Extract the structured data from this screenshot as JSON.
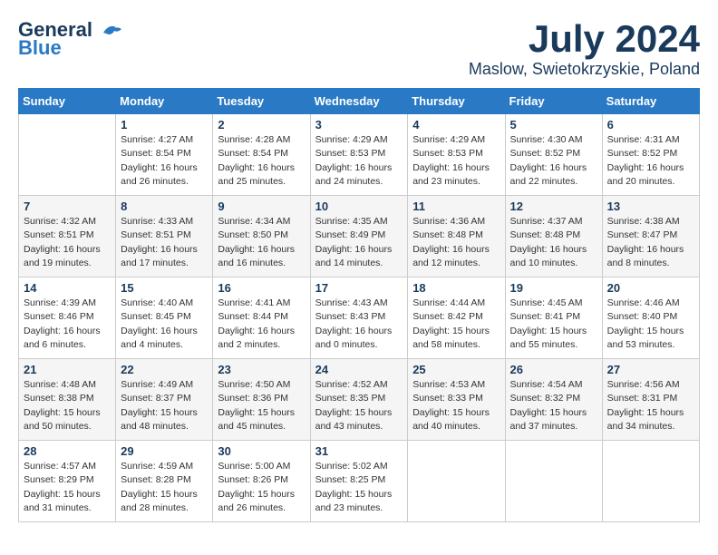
{
  "header": {
    "logo_general": "General",
    "logo_blue": "Blue",
    "month_year": "July 2024",
    "location": "Maslow, Swietokrzyskie, Poland"
  },
  "weekdays": [
    "Sunday",
    "Monday",
    "Tuesday",
    "Wednesday",
    "Thursday",
    "Friday",
    "Saturday"
  ],
  "weeks": [
    [
      {
        "day": "",
        "sunrise": "",
        "sunset": "",
        "daylight": ""
      },
      {
        "day": "1",
        "sunrise": "Sunrise: 4:27 AM",
        "sunset": "Sunset: 8:54 PM",
        "daylight": "Daylight: 16 hours and 26 minutes."
      },
      {
        "day": "2",
        "sunrise": "Sunrise: 4:28 AM",
        "sunset": "Sunset: 8:54 PM",
        "daylight": "Daylight: 16 hours and 25 minutes."
      },
      {
        "day": "3",
        "sunrise": "Sunrise: 4:29 AM",
        "sunset": "Sunset: 8:53 PM",
        "daylight": "Daylight: 16 hours and 24 minutes."
      },
      {
        "day": "4",
        "sunrise": "Sunrise: 4:29 AM",
        "sunset": "Sunset: 8:53 PM",
        "daylight": "Daylight: 16 hours and 23 minutes."
      },
      {
        "day": "5",
        "sunrise": "Sunrise: 4:30 AM",
        "sunset": "Sunset: 8:52 PM",
        "daylight": "Daylight: 16 hours and 22 minutes."
      },
      {
        "day": "6",
        "sunrise": "Sunrise: 4:31 AM",
        "sunset": "Sunset: 8:52 PM",
        "daylight": "Daylight: 16 hours and 20 minutes."
      }
    ],
    [
      {
        "day": "7",
        "sunrise": "Sunrise: 4:32 AM",
        "sunset": "Sunset: 8:51 PM",
        "daylight": "Daylight: 16 hours and 19 minutes."
      },
      {
        "day": "8",
        "sunrise": "Sunrise: 4:33 AM",
        "sunset": "Sunset: 8:51 PM",
        "daylight": "Daylight: 16 hours and 17 minutes."
      },
      {
        "day": "9",
        "sunrise": "Sunrise: 4:34 AM",
        "sunset": "Sunset: 8:50 PM",
        "daylight": "Daylight: 16 hours and 16 minutes."
      },
      {
        "day": "10",
        "sunrise": "Sunrise: 4:35 AM",
        "sunset": "Sunset: 8:49 PM",
        "daylight": "Daylight: 16 hours and 14 minutes."
      },
      {
        "day": "11",
        "sunrise": "Sunrise: 4:36 AM",
        "sunset": "Sunset: 8:48 PM",
        "daylight": "Daylight: 16 hours and 12 minutes."
      },
      {
        "day": "12",
        "sunrise": "Sunrise: 4:37 AM",
        "sunset": "Sunset: 8:48 PM",
        "daylight": "Daylight: 16 hours and 10 minutes."
      },
      {
        "day": "13",
        "sunrise": "Sunrise: 4:38 AM",
        "sunset": "Sunset: 8:47 PM",
        "daylight": "Daylight: 16 hours and 8 minutes."
      }
    ],
    [
      {
        "day": "14",
        "sunrise": "Sunrise: 4:39 AM",
        "sunset": "Sunset: 8:46 PM",
        "daylight": "Daylight: 16 hours and 6 minutes."
      },
      {
        "day": "15",
        "sunrise": "Sunrise: 4:40 AM",
        "sunset": "Sunset: 8:45 PM",
        "daylight": "Daylight: 16 hours and 4 minutes."
      },
      {
        "day": "16",
        "sunrise": "Sunrise: 4:41 AM",
        "sunset": "Sunset: 8:44 PM",
        "daylight": "Daylight: 16 hours and 2 minutes."
      },
      {
        "day": "17",
        "sunrise": "Sunrise: 4:43 AM",
        "sunset": "Sunset: 8:43 PM",
        "daylight": "Daylight: 16 hours and 0 minutes."
      },
      {
        "day": "18",
        "sunrise": "Sunrise: 4:44 AM",
        "sunset": "Sunset: 8:42 PM",
        "daylight": "Daylight: 15 hours and 58 minutes."
      },
      {
        "day": "19",
        "sunrise": "Sunrise: 4:45 AM",
        "sunset": "Sunset: 8:41 PM",
        "daylight": "Daylight: 15 hours and 55 minutes."
      },
      {
        "day": "20",
        "sunrise": "Sunrise: 4:46 AM",
        "sunset": "Sunset: 8:40 PM",
        "daylight": "Daylight: 15 hours and 53 minutes."
      }
    ],
    [
      {
        "day": "21",
        "sunrise": "Sunrise: 4:48 AM",
        "sunset": "Sunset: 8:38 PM",
        "daylight": "Daylight: 15 hours and 50 minutes."
      },
      {
        "day": "22",
        "sunrise": "Sunrise: 4:49 AM",
        "sunset": "Sunset: 8:37 PM",
        "daylight": "Daylight: 15 hours and 48 minutes."
      },
      {
        "day": "23",
        "sunrise": "Sunrise: 4:50 AM",
        "sunset": "Sunset: 8:36 PM",
        "daylight": "Daylight: 15 hours and 45 minutes."
      },
      {
        "day": "24",
        "sunrise": "Sunrise: 4:52 AM",
        "sunset": "Sunset: 8:35 PM",
        "daylight": "Daylight: 15 hours and 43 minutes."
      },
      {
        "day": "25",
        "sunrise": "Sunrise: 4:53 AM",
        "sunset": "Sunset: 8:33 PM",
        "daylight": "Daylight: 15 hours and 40 minutes."
      },
      {
        "day": "26",
        "sunrise": "Sunrise: 4:54 AM",
        "sunset": "Sunset: 8:32 PM",
        "daylight": "Daylight: 15 hours and 37 minutes."
      },
      {
        "day": "27",
        "sunrise": "Sunrise: 4:56 AM",
        "sunset": "Sunset: 8:31 PM",
        "daylight": "Daylight: 15 hours and 34 minutes."
      }
    ],
    [
      {
        "day": "28",
        "sunrise": "Sunrise: 4:57 AM",
        "sunset": "Sunset: 8:29 PM",
        "daylight": "Daylight: 15 hours and 31 minutes."
      },
      {
        "day": "29",
        "sunrise": "Sunrise: 4:59 AM",
        "sunset": "Sunset: 8:28 PM",
        "daylight": "Daylight: 15 hours and 28 minutes."
      },
      {
        "day": "30",
        "sunrise": "Sunrise: 5:00 AM",
        "sunset": "Sunset: 8:26 PM",
        "daylight": "Daylight: 15 hours and 26 minutes."
      },
      {
        "day": "31",
        "sunrise": "Sunrise: 5:02 AM",
        "sunset": "Sunset: 8:25 PM",
        "daylight": "Daylight: 15 hours and 23 minutes."
      },
      {
        "day": "",
        "sunrise": "",
        "sunset": "",
        "daylight": ""
      },
      {
        "day": "",
        "sunrise": "",
        "sunset": "",
        "daylight": ""
      },
      {
        "day": "",
        "sunrise": "",
        "sunset": "",
        "daylight": ""
      }
    ]
  ]
}
